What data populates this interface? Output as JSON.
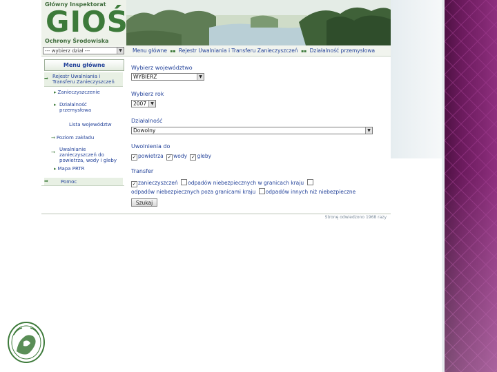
{
  "header": {
    "org_line1": "Główny Inspektorat",
    "org_abbr": "GIOŚ",
    "org_line2": "Ochrony Środowiska"
  },
  "navbar": {
    "top_select_value": "--- wybierz dział ---",
    "breadcrumbs": [
      "Menu główne",
      "Rejestr Uwalniania i Transferu Zanieczyszczeń",
      "Działalność przemysłowa"
    ]
  },
  "sidebar": {
    "menu_title": "Menu główne",
    "items": [
      {
        "label": "Rejestr Uwalniania i Transferu Zanieczyszczeń",
        "icon": "arrow-right-icon"
      },
      {
        "label": "Zanieczyszczenie",
        "icon": "triangle-right-icon"
      },
      {
        "label": "Działalność przemysłowa",
        "icon": "triangle-right-icon"
      },
      {
        "label": "Lista województw",
        "icon": ""
      },
      {
        "label": "Poziom zakładu",
        "icon": "arrow-right-icon"
      },
      {
        "label": "Uwalnianie zanieczyszczeń do powietrza, wody i gleby",
        "icon": "arrow-right-icon"
      },
      {
        "label": "Mapa PRTR",
        "icon": "triangle-right-icon"
      },
      {
        "label": "Pomoc",
        "icon": "arrow-right-icon"
      }
    ]
  },
  "form": {
    "voivodeship": {
      "label": "Wybierz województwo",
      "value": "WYBIERZ"
    },
    "year": {
      "label": "Wybierz rok",
      "value": "2007"
    },
    "activity": {
      "label": "Działalność",
      "value": "Dowolny"
    },
    "releases": {
      "label": "Uwolnienia do",
      "options": [
        {
          "label": "powietrza",
          "checked": true
        },
        {
          "label": "wody",
          "checked": true
        },
        {
          "label": "gleby",
          "checked": true
        }
      ]
    },
    "transfer": {
      "label": "Transfer",
      "options": [
        {
          "label": "zanieczyszczeń",
          "checked": true
        },
        {
          "label": "odpadów niebezpiecznych w granicach kraju",
          "checked": false
        },
        {
          "label": "odpadów niebezpiecznych poza granicami kraju",
          "checked": false
        },
        {
          "label": "odpadów innych niż niebezpieczne",
          "checked": false
        }
      ]
    },
    "search_button": "Szukaj"
  },
  "footer": {
    "counter": "Stronę odwiedzono 1968 razy"
  },
  "colors": {
    "brand_green": "#3d7a3a",
    "link_blue": "#24439a",
    "deco_purple": "#6a1a5c"
  }
}
